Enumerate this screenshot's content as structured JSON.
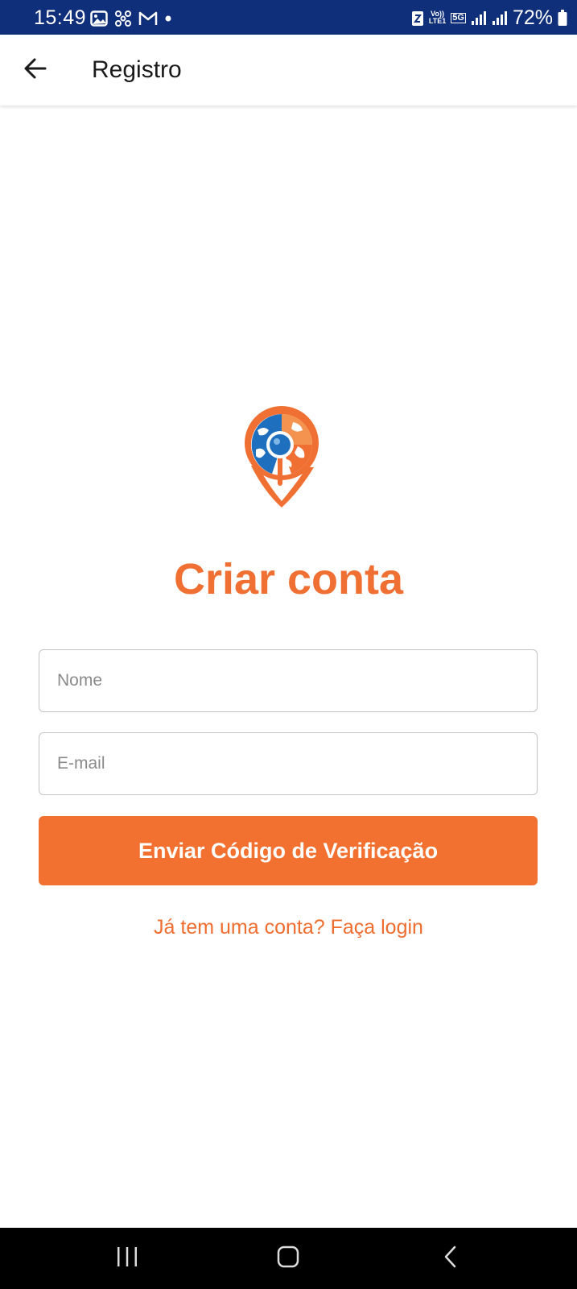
{
  "status_bar": {
    "time": "15:49",
    "battery": "72%",
    "left_icons": [
      "gallery-icon",
      "pinwheel-icon",
      "gmail-icon",
      "dot-icon"
    ],
    "right_icons": [
      "data-saver-icon",
      "volte-icon",
      "5g-icon",
      "signal-icon",
      "signal-icon",
      "battery-icon"
    ],
    "volte_top": "Vo))",
    "volte_bottom": "LTE1",
    "network": "5G"
  },
  "app_bar": {
    "title": "Registro",
    "back_icon": "arrow-back-icon"
  },
  "main": {
    "logo_icon": "globe-location-pin-logo",
    "heading": "Criar conta",
    "name_placeholder": "Nome",
    "email_placeholder": "E-mail",
    "submit_label": "Enviar Código de Verificação",
    "login_link": "Já tem uma conta? Faça login"
  },
  "colors": {
    "accent": "#f37130",
    "status_bar": "#0f2f7a",
    "globe_blue": "#1f6fbf"
  },
  "nav_bar": {
    "buttons": [
      "recents-icon",
      "home-icon",
      "back-icon"
    ]
  }
}
